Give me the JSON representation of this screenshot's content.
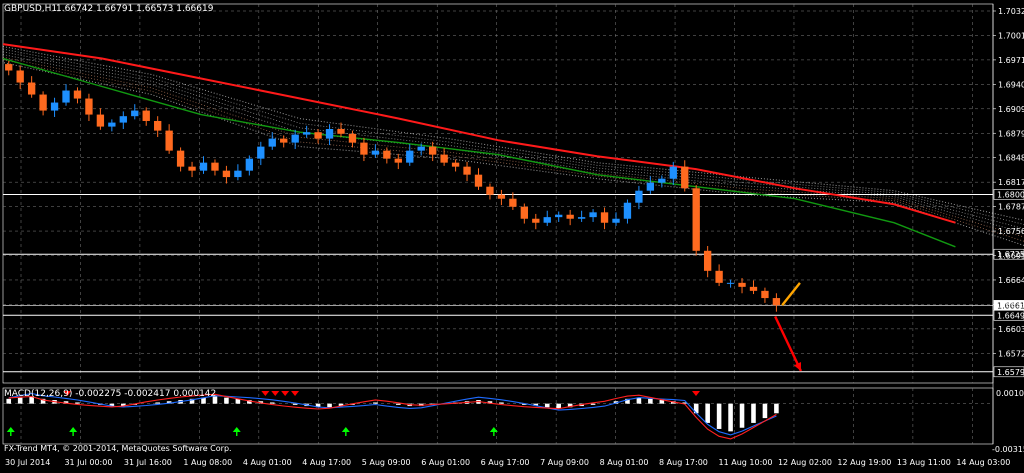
{
  "main_header": {
    "symbol": "GBPUSD,H1",
    "ohlc": "1.66742 1.66791 1.66573 1.66619"
  },
  "price_axis": {
    "ticks": [
      "1.70320",
      "1.70015",
      "1.69710",
      "1.69400",
      "1.69095",
      "1.68790",
      "1.68480",
      "1.68175",
      "1.67870",
      "1.67560",
      "1.66950",
      "1.66640",
      "1.66335",
      "1.66030",
      "1.65725"
    ],
    "highlighted": [
      {
        "label": "1.68003",
        "kind": "level"
      },
      {
        "label": "1.67257",
        "kind": "level"
      },
      {
        "label": "1.66619",
        "kind": "current"
      },
      {
        "label": "1.66495",
        "kind": "level"
      },
      {
        "label": "1.65790",
        "kind": "level"
      }
    ]
  },
  "macd_header": {
    "label": "MACD(12,26,9) -0.002275 -0.002417 0.000142"
  },
  "macd_axis": {
    "ticks": [
      "0.00104",
      "-0.003151"
    ]
  },
  "time_axis": {
    "labels": [
      "30 Jul 2014",
      "31 Jul 00:00",
      "31 Jul 16:00",
      "1 Aug 08:00",
      "4 Aug 01:00",
      "4 Aug 17:00",
      "5 Aug 09:00",
      "6 Aug 01:00",
      "6 Aug 17:00",
      "7 Aug 09:00",
      "8 Aug 01:00",
      "8 Aug 17:00",
      "11 Aug 10:00",
      "12 Aug 02:00",
      "12 Aug 19:00",
      "13 Aug 11:00",
      "14 Aug 03:00"
    ]
  },
  "copyright": "FX-Trend MT4, © 2001-2014, MetaQuotes Software Corp.",
  "colors": {
    "background": "#000000",
    "grid": "#7f7f7f",
    "bull_candle": "#1e90ff",
    "bear_candle": "#ff6a1f",
    "ma_red": "#ff1a1a",
    "ma_green": "#119911",
    "cloud": "#d9d9d9",
    "cloud_orange": "#e6a07a",
    "macd_hist": "#ffffff",
    "macd_blue": "#1e6bff",
    "macd_red": "#ff2020",
    "arrow_red": "#ff0000",
    "arrow_orange": "#ffa500",
    "signal_green": "#00ff00"
  },
  "chart_data": {
    "type": "candlestick",
    "symbol": "GBPUSD",
    "timeframe": "H1",
    "ylim": [
      1.6565,
      1.7038
    ],
    "current_price": 1.66619,
    "horizontal_levels": [
      1.68003,
      1.67257,
      1.66495,
      1.6579
    ],
    "price_path": [
      1.6955,
      1.694,
      1.6925,
      1.6905,
      1.6915,
      1.693,
      1.692,
      1.69,
      1.6885,
      1.689,
      1.6898,
      1.6905,
      1.6892,
      1.688,
      1.6855,
      1.6835,
      1.683,
      1.684,
      1.683,
      1.6822,
      1.683,
      1.6845,
      1.686,
      1.687,
      1.6865,
      1.6875,
      1.6878,
      1.687,
      1.6882,
      1.6876,
      1.6865,
      1.685,
      1.6855,
      1.6845,
      1.684,
      1.6855,
      1.686,
      1.685,
      1.684,
      1.6835,
      1.6825,
      1.681,
      1.68,
      1.6795,
      1.6785,
      1.677,
      1.6765,
      1.6772,
      1.6775,
      1.677,
      1.6772,
      1.6778,
      1.6765,
      1.677,
      1.679,
      1.6805,
      1.6815,
      1.682,
      1.6835,
      1.6808,
      1.673,
      1.6705,
      1.669,
      1.669,
      1.6685,
      1.668,
      1.6671,
      1.6662
    ],
    "price_end_offset": 0.787,
    "ma_red": [
      [
        0.0,
        1.6988
      ],
      [
        0.1,
        1.697
      ],
      [
        0.2,
        1.6945
      ],
      [
        0.3,
        1.692
      ],
      [
        0.4,
        1.6895
      ],
      [
        0.5,
        1.6868
      ],
      [
        0.6,
        1.6848
      ],
      [
        0.7,
        1.6832
      ],
      [
        0.8,
        1.6808
      ],
      [
        0.9,
        1.6788
      ],
      [
        0.962,
        1.6765
      ]
    ],
    "ma_green": [
      [
        0.0,
        1.697
      ],
      [
        0.1,
        1.6935
      ],
      [
        0.2,
        1.69
      ],
      [
        0.3,
        1.6878
      ],
      [
        0.4,
        1.6865
      ],
      [
        0.5,
        1.685
      ],
      [
        0.6,
        1.6825
      ],
      [
        0.7,
        1.681
      ],
      [
        0.8,
        1.6795
      ],
      [
        0.9,
        1.6765
      ],
      [
        0.962,
        1.6735
      ]
    ],
    "cloud": {
      "upper": [
        [
          0.0,
          1.6985
        ],
        [
          0.15,
          1.695
        ],
        [
          0.3,
          1.6895
        ],
        [
          0.45,
          1.687
        ],
        [
          0.6,
          1.684
        ],
        [
          0.75,
          1.6822
        ],
        [
          0.9,
          1.6805
        ],
        [
          1.06,
          1.676
        ]
      ],
      "lower": [
        [
          0.0,
          1.6965
        ],
        [
          0.15,
          1.6925
        ],
        [
          0.3,
          1.686
        ],
        [
          0.45,
          1.6845
        ],
        [
          0.6,
          1.682
        ],
        [
          0.75,
          1.68
        ],
        [
          0.9,
          1.679
        ],
        [
          1.06,
          1.6725
        ]
      ]
    },
    "arrows": [
      {
        "color": "orange",
        "from": [
          0.787,
          1.6662
        ],
        "to": [
          0.805,
          1.669
        ]
      },
      {
        "color": "red",
        "from": [
          0.78,
          1.6648
        ],
        "to": [
          0.806,
          1.658
        ]
      }
    ],
    "macd": {
      "ylim": [
        -0.00335,
        0.0013
      ],
      "histogram": [
        0.0004,
        0.0005,
        0.0006,
        0.0004,
        0.0003,
        0.0002,
        0.0001,
        0.0,
        -0.0001,
        -0.0002,
        -0.0002,
        -0.0001,
        0.0,
        0.0001,
        0.0002,
        0.0003,
        0.0004,
        0.0005,
        0.0006,
        0.0005,
        0.0004,
        0.0003,
        0.0002,
        0.0001,
        0.0,
        -0.0001,
        -0.0002,
        -0.0003,
        -0.0003,
        -0.0002,
        -0.0001,
        0.0,
        0.0001,
        0.0,
        -0.0001,
        -0.0002,
        -0.0002,
        -0.0001,
        0.0,
        0.0001,
        0.0002,
        0.0003,
        0.0002,
        0.0001,
        0.0,
        -0.0001,
        -0.0002,
        -0.0003,
        -0.0004,
        -0.0003,
        -0.0002,
        -0.0001,
        0.0,
        0.0002,
        0.0004,
        0.0005,
        0.0004,
        0.0003,
        0.0002,
        0.0001,
        -0.0008,
        -0.0016,
        -0.0021,
        -0.0023,
        -0.002,
        -0.0016,
        -0.0012,
        -0.0008
      ],
      "signal_up_positions": [
        0.01,
        0.09,
        0.3,
        0.44,
        0.63
      ],
      "signal_down_positions": [
        0.065,
        0.265,
        0.275,
        0.285,
        0.295,
        0.7
      ]
    }
  }
}
